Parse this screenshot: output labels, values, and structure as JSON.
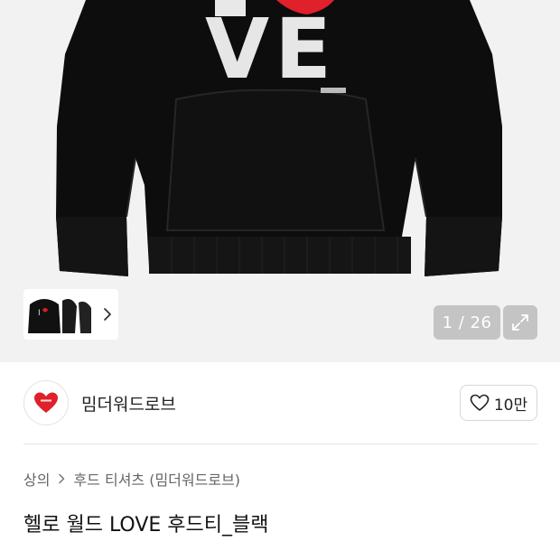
{
  "gallery": {
    "print_text": "VE",
    "counter": "1 / 26",
    "thumbnail_label": "I",
    "icons": {
      "more": "chevron-right-icon",
      "expand": "expand-arrows-icon"
    }
  },
  "brand": {
    "name": "밈더워드로브",
    "logo": "heart-logo",
    "like_count": "10만",
    "like_icon": "heart-outline-icon"
  },
  "breadcrumb": {
    "items": [
      "상의",
      "후드 티셔츠 (밈더워드로브)"
    ],
    "separator_icon": "chevron-right-icon"
  },
  "product": {
    "title": "헬로 월드 LOVE 후드티_블랙"
  },
  "colors": {
    "hoodie": "#0d0d0d",
    "heart": "#e0202a",
    "gallery_bg": "#f2f2f2",
    "overlay": "rgba(140,140,140,0.45)"
  }
}
